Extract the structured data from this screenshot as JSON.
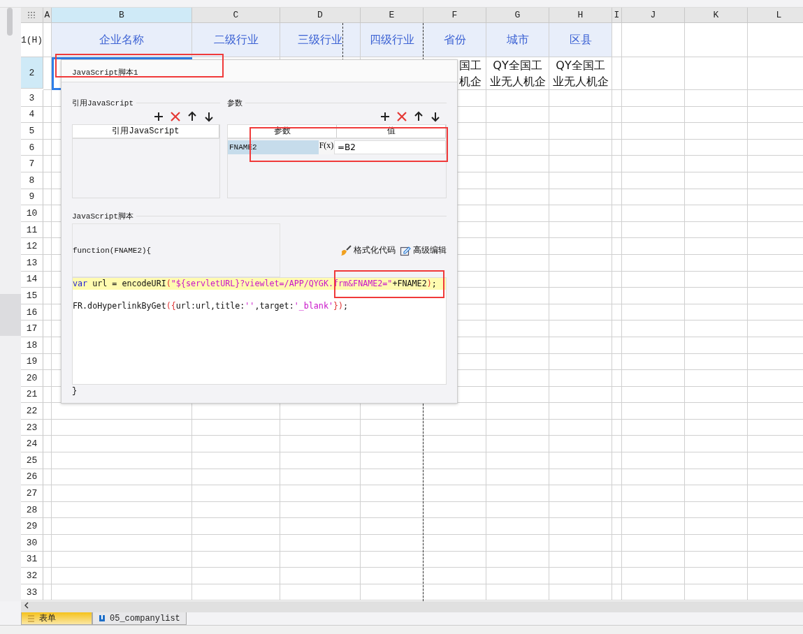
{
  "columns": [
    {
      "label": "A",
      "selected": false
    },
    {
      "label": "B",
      "selected": true
    },
    {
      "label": "C",
      "selected": false
    },
    {
      "label": "D",
      "selected": false
    },
    {
      "label": "E",
      "selected": false
    },
    {
      "label": "F",
      "selected": false
    },
    {
      "label": "G",
      "selected": false
    },
    {
      "label": "H",
      "selected": false
    },
    {
      "label": "I",
      "selected": false
    },
    {
      "label": "J",
      "selected": false
    },
    {
      "label": "K",
      "selected": false
    },
    {
      "label": "L",
      "selected": false
    }
  ],
  "header_row": {
    "label": "1(H)",
    "selected": false,
    "cells": [
      "企业名称",
      "二级行业",
      "三级行业",
      "四级行业",
      "省份",
      "城市",
      "区县"
    ]
  },
  "data_row": {
    "label": "2",
    "selected": true,
    "cells": [
      {
        "selected": true
      },
      {
        "lines": [
          "国工",
          "机企"
        ],
        "selected": false
      },
      {
        "lines": [
          "QY全国工",
          "业无人机企"
        ],
        "selected": false
      },
      {
        "lines": [
          "QY全国工",
          "业无人机企"
        ],
        "selected": false
      }
    ]
  },
  "empty_rows": [
    "3",
    "4",
    "5",
    "6",
    "7",
    "8",
    "9",
    "10",
    "11",
    "12",
    "13",
    "14",
    "15",
    "16",
    "17",
    "18",
    "19",
    "20",
    "21",
    "22",
    "23",
    "24",
    "25",
    "26",
    "27",
    "28",
    "29",
    "30",
    "31",
    "32",
    "33"
  ],
  "dialog": {
    "title": "JavaScript脚本1",
    "imports": {
      "title": "引用JavaScript",
      "column": "引用JavaScript"
    },
    "params": {
      "title": "参数",
      "columns": [
        "参数",
        "值"
      ],
      "rows": [
        {
          "name": "FNAME2",
          "formula_button": "F(x)",
          "value": "=B2",
          "selected": true
        }
      ]
    },
    "script": {
      "title": "JavaScript脚本",
      "signature": "function(FNAME2){",
      "format_button": "格式化代码",
      "advanced_button": "高级编辑",
      "lines": [
        {
          "current": true,
          "tokens": [
            {
              "kind": "keyword",
              "text": "var"
            },
            {
              "kind": "plain",
              "text": " url = encodeURI"
            },
            {
              "kind": "paren",
              "text": "("
            },
            {
              "kind": "string",
              "text": "\"${servletURL}?viewlet=/APP/QYGK.frm&FNAME2=\""
            },
            {
              "kind": "plain",
              "text": "+FNAME2"
            },
            {
              "kind": "paren",
              "text": ")"
            },
            {
              "kind": "plain",
              "text": ";"
            }
          ]
        },
        {
          "current": false,
          "tokens": [
            {
              "kind": "plain",
              "text": "FR.doHyperlinkByGet"
            },
            {
              "kind": "paren",
              "text": "({"
            },
            {
              "kind": "plain",
              "text": "url:url,title:"
            },
            {
              "kind": "string",
              "text": "''"
            },
            {
              "kind": "plain",
              "text": ",target:"
            },
            {
              "kind": "string",
              "text": "'_blank'"
            },
            {
              "kind": "paren",
              "text": "})"
            },
            {
              "kind": "plain",
              "text": ";"
            }
          ]
        }
      ],
      "closing": "}"
    }
  },
  "sheet_tabs": [
    {
      "label": "表单",
      "kind": "form",
      "selected": true
    },
    {
      "label": "05_companylist",
      "kind": "report",
      "selected": false
    }
  ]
}
